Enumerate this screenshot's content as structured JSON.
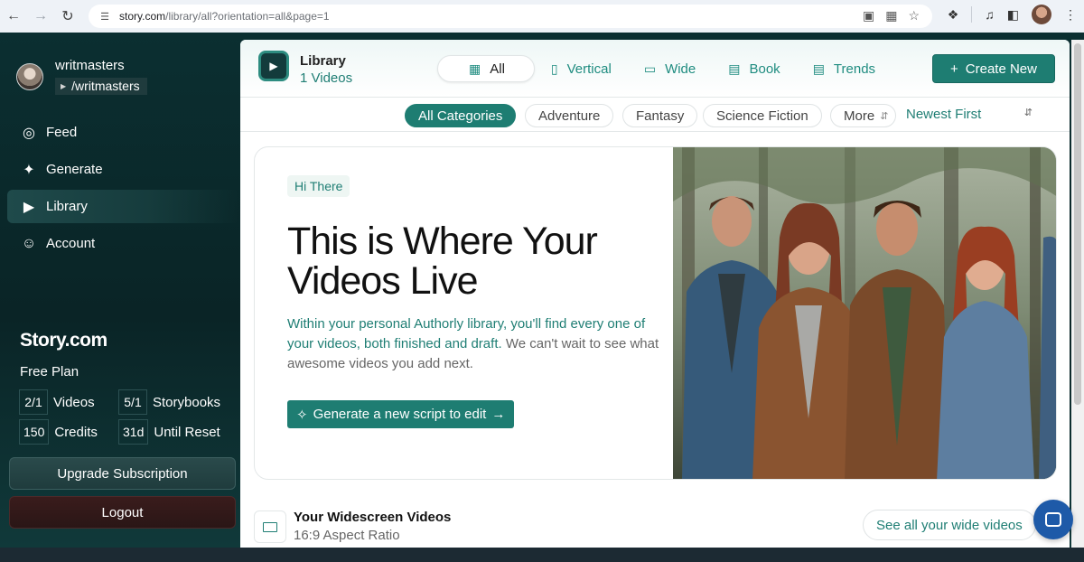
{
  "browser": {
    "url_host": "story.com",
    "url_path": "/library/all?orientation=all&page=1"
  },
  "sidebar": {
    "username": "writmasters",
    "handle": "/writmasters",
    "nav": [
      {
        "label": "Feed",
        "icon": "play-circle-icon"
      },
      {
        "label": "Generate",
        "icon": "sparkle-icon"
      },
      {
        "label": "Library",
        "icon": "library-icon",
        "active": true
      },
      {
        "label": "Account",
        "icon": "user-circle-icon"
      }
    ],
    "brand": "Story.com",
    "plan": "Free Plan",
    "stats": [
      {
        "value": "2/1",
        "label": "Videos"
      },
      {
        "value": "5/1",
        "label": "Storybooks"
      },
      {
        "value": "150",
        "label": "Credits"
      },
      {
        "value": "31d",
        "label": "Until Reset"
      }
    ],
    "upgrade_label": "Upgrade Subscription",
    "logout_label": "Logout"
  },
  "header": {
    "title": "Library",
    "count": "1 Videos",
    "tabs": [
      {
        "label": "All",
        "icon": "grid-icon",
        "active": true
      },
      {
        "label": "Vertical",
        "icon": "portrait-icon"
      },
      {
        "label": "Wide",
        "icon": "landscape-icon"
      },
      {
        "label": "Book",
        "icon": "book-icon"
      },
      {
        "label": "Trends",
        "icon": "trends-icon"
      }
    ],
    "create_label": "Create New"
  },
  "filters": {
    "categories": [
      {
        "label": "All Categories",
        "active": true
      },
      {
        "label": "Adventure"
      },
      {
        "label": "Fantasy"
      },
      {
        "label": "Science Fiction"
      },
      {
        "label": "More"
      }
    ],
    "sort": "Newest First"
  },
  "hero": {
    "badge": "Hi There",
    "title": "This is Where Your Videos Live",
    "body_highlight": "Within your personal Authorly library, you'll find every one of your videos, both finished and draft.",
    "body_rest": " We can't wait to see what awesome videos you add next.",
    "button_label": "Generate a new script to edit",
    "image_alt": "group of five young adults in a forest"
  },
  "section": {
    "title": "Your Widescreen Videos",
    "subtitle": "16:9 Aspect Ratio",
    "see_all": "See all your wide videos"
  },
  "colors": {
    "accent": "#1e7d72",
    "sidebar_bg": "#0b2b2e",
    "chat_fab": "#1e5aa8"
  }
}
